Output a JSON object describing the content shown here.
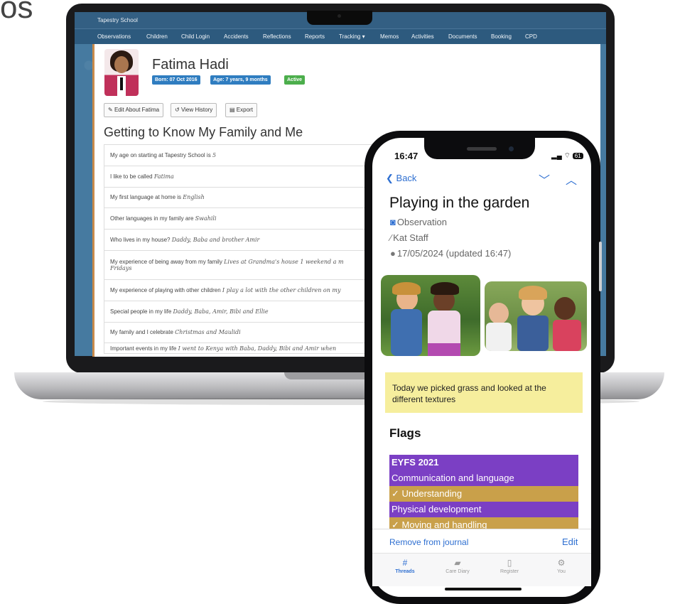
{
  "corner_text": "os",
  "laptop": {
    "app": {
      "school_name": "Tapestry School",
      "nav_items": [
        "Observations",
        "Children",
        "Child Login",
        "Accidents",
        "Reflections",
        "Reports",
        "Tracking ▾",
        "Memos",
        "Activities",
        "Documents",
        "Booking",
        "CPD"
      ]
    },
    "child": {
      "name": "Fatima Hadi",
      "born": "Born: 07 Oct 2016",
      "age": "Age: 7 years, 9 months",
      "status": "Active"
    },
    "actions": {
      "edit": "Edit About Fatima",
      "history": "View History",
      "export": "Export"
    },
    "section_title": "Getting to Know My Family and Me",
    "rows": [
      {
        "q": "My age on starting at Tapestry School is",
        "a": "5"
      },
      {
        "q": "I like to be called",
        "a": "Fatima"
      },
      {
        "q": "My first language at home is",
        "a": "English"
      },
      {
        "q": "Other languages in my family are",
        "a": "Swahili"
      },
      {
        "q": "Who lives in my house?",
        "a": "Daddy, Baba and brother Amir"
      },
      {
        "q": "My experience of being away from my family",
        "a": "Lives at Grandma's house 1 weekend a m",
        "a2": "Fridays"
      },
      {
        "q": "My experience of playing with other children",
        "a": "I play a lot with the other children on my"
      },
      {
        "q": "Special people in my life",
        "a": "Daddy, Baba, Amir, Bibi and Ellie"
      },
      {
        "q": "My family and I celebrate",
        "a": "Christmas and Maulidi"
      },
      {
        "q": "Important events in my life",
        "a": "I went to Kenya with Baba, Daddy, Bibi and Amir when"
      }
    ]
  },
  "phone": {
    "status_time": "16:47",
    "battery": "61",
    "back_label": "Back",
    "title": "Playing in the garden",
    "type_label": "Observation",
    "author": "Kat Staff",
    "date": "17/05/2024 (updated 16:47)",
    "note": "Today we picked grass and looked at the different textures",
    "flags_title": "Flags",
    "flags": [
      {
        "label": "EYFS 2021",
        "style": "purple",
        "bold": true
      },
      {
        "label": "Communication and language",
        "style": "purple",
        "bold": false
      },
      {
        "label": "✓ Understanding",
        "style": "gold",
        "bold": false
      },
      {
        "label": "Physical development",
        "style": "purple",
        "bold": false
      },
      {
        "label": "✓ Moving and handling",
        "style": "gold",
        "bold": false
      }
    ],
    "remove_label": "Remove from journal",
    "edit_label": "Edit",
    "tabs": [
      {
        "label": "Threads",
        "icon": "threads-icon",
        "active": true
      },
      {
        "label": "Care Diary",
        "icon": "book-icon",
        "active": false
      },
      {
        "label": "Register",
        "icon": "register-icon",
        "active": false
      },
      {
        "label": "You",
        "icon": "gear-icon",
        "active": false
      }
    ],
    "colors": {
      "link": "#2e6fd1",
      "flag_purple": "#7b3fc4",
      "flag_gold": "#c9a04a",
      "note_bg": "#f6ee9d"
    }
  }
}
